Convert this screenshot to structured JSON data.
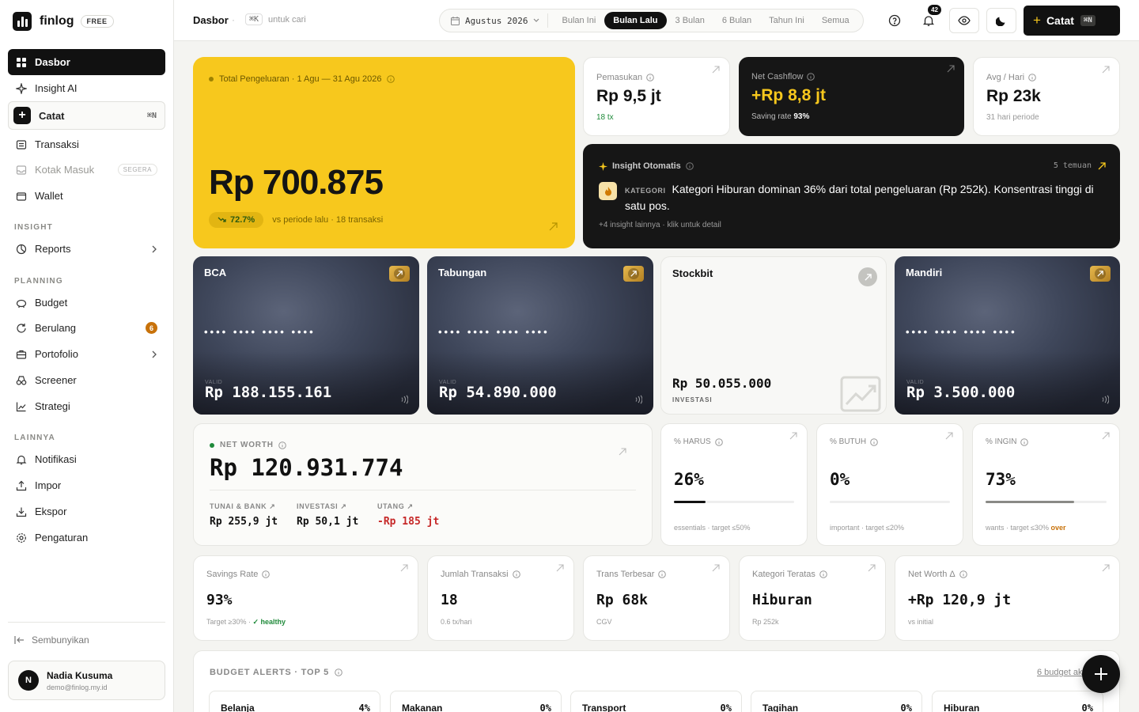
{
  "app": {
    "name": "finlog",
    "plan_badge": "FREE"
  },
  "sidebar": {
    "nav": [
      {
        "label": "Dasbor"
      },
      {
        "label": "Insight AI"
      },
      {
        "label": "Catat",
        "shortcut": "⌘N"
      },
      {
        "label": "Transaksi"
      },
      {
        "label": "Kotak Masuk",
        "badge": "SEGERA"
      },
      {
        "label": "Wallet"
      }
    ],
    "sections": {
      "insight": "INSIGHT",
      "planning": "PLANNING",
      "other": "LAINNYA"
    },
    "insight_items": [
      {
        "label": "Reports"
      }
    ],
    "planning_items": [
      {
        "label": "Budget"
      },
      {
        "label": "Berulang",
        "count": "6"
      },
      {
        "label": "Portofolio"
      },
      {
        "label": "Screener"
      },
      {
        "label": "Strategi"
      }
    ],
    "other_items": [
      {
        "label": "Notifikasi"
      },
      {
        "label": "Impor"
      },
      {
        "label": "Ekspor"
      },
      {
        "label": "Pengaturan"
      }
    ],
    "hide_label": "Sembunyikan",
    "user": {
      "initial": "N",
      "name": "Nadia Kusuma",
      "email": "demo@finlog.my.id"
    }
  },
  "topbar": {
    "breadcrumb": "Dasbor",
    "search_shortcut": "⌘K",
    "search_hint": "untuk cari",
    "period_selected": "Agustus 2026",
    "period_tabs": [
      "Bulan Ini",
      "Bulan Lalu",
      "3 Bulan",
      "6 Bulan",
      "Tahun Ini",
      "Semua"
    ],
    "active_tab": "Bulan Lalu",
    "notif_count": "42",
    "catat_label": "Catat",
    "catat_shortcut": "⌘N"
  },
  "hero": {
    "label": "Total Pengeluaran · 1 Agu — 31 Agu 2026",
    "amount": "Rp 700.875",
    "change": "72.7%",
    "subtext": "vs periode lalu · 18 transaksi"
  },
  "kpis": {
    "income": {
      "label": "Pemasukan",
      "value": "Rp 9,5 jt",
      "sub": "18 tx"
    },
    "cashflow": {
      "label": "Net Cashflow",
      "value": "+Rp 8,8 jt",
      "sub_prefix": "Saving rate",
      "sub_value": "93%"
    },
    "avg": {
      "label": "Avg / Hari",
      "value": "Rp 23k",
      "sub": "31 hari periode"
    }
  },
  "insight": {
    "title": "Insight Otomatis",
    "findings": "5 temuan",
    "tag": "KATEGORI",
    "text": "Kategori Hiburan dominan 36% dari total pengeluaran (Rp 252k). Konsentrasi tinggi di satu pos.",
    "more": "+4 insight lainnya · klik untuk detail"
  },
  "accounts": [
    {
      "name": "BCA",
      "dots": "•••• •••• •••• ••••",
      "balance": "Rp 188.155.161",
      "watermark": "VALID"
    },
    {
      "name": "Tabungan",
      "dots": "•••• •••• •••• ••••",
      "balance": "Rp 54.890.000",
      "watermark": "VALID"
    },
    {
      "name": "Stockbit",
      "balance": "Rp 50.055.000",
      "type": "INVESTASI"
    },
    {
      "name": "Mandiri",
      "dots": "•••• •••• •••• ••••",
      "balance": "Rp 3.500.000",
      "watermark": "VALID"
    }
  ],
  "net_worth": {
    "label": "NET WORTH",
    "value": "Rp 120.931.774",
    "breakdown": [
      {
        "label": "TUNAI & BANK",
        "value": "Rp 255,9 jt"
      },
      {
        "label": "INVESTASI",
        "value": "Rp 50,1 jt"
      },
      {
        "label": "UTANG",
        "value": "-Rp 185 jt"
      }
    ]
  },
  "allocation": [
    {
      "label": "% HARUS",
      "value": "26%",
      "fill": 0.26,
      "note": "essentials · target ≤50%",
      "over": "",
      "color": "#111111"
    },
    {
      "label": "% BUTUH",
      "value": "0%",
      "fill": 0,
      "note": "important · target ≤20%",
      "over": "",
      "color": "#111111"
    },
    {
      "label": "% INGIN",
      "value": "73%",
      "fill": 0.73,
      "note": "wants · target ≤30%",
      "over": "over",
      "color": "#8a8a86"
    }
  ],
  "stats": [
    {
      "label": "Savings Rate",
      "value": "93%",
      "note": "Target ≥30% ·",
      "good": "✓ healthy"
    },
    {
      "label": "Jumlah Transaksi",
      "value": "18",
      "note": "0.6 tx/hari"
    },
    {
      "label": "Trans Terbesar",
      "value": "Rp 68k",
      "note": "CGV"
    },
    {
      "label": "Kategori Teratas",
      "value": "Hiburan",
      "note": "Rp 252k"
    },
    {
      "label": "Net Worth Δ",
      "value": "+Rp 120,9 jt",
      "note": "vs initial"
    }
  ],
  "budget": {
    "title": "BUDGET ALERTS · TOP 5",
    "link": "6 budget aktif",
    "items": [
      {
        "name": "Belanja",
        "pct": "4%"
      },
      {
        "name": "Makanan",
        "pct": "0%"
      },
      {
        "name": "Transport",
        "pct": "0%"
      },
      {
        "name": "Tagihan",
        "pct": "0%"
      },
      {
        "name": "Hiburan",
        "pct": "0%"
      }
    ]
  },
  "colors": {
    "accent_yellow": "#f7c81d",
    "dark": "#161616",
    "positive": "#1f8a3a",
    "negative": "#c62828",
    "warning": "#c8720a"
  }
}
